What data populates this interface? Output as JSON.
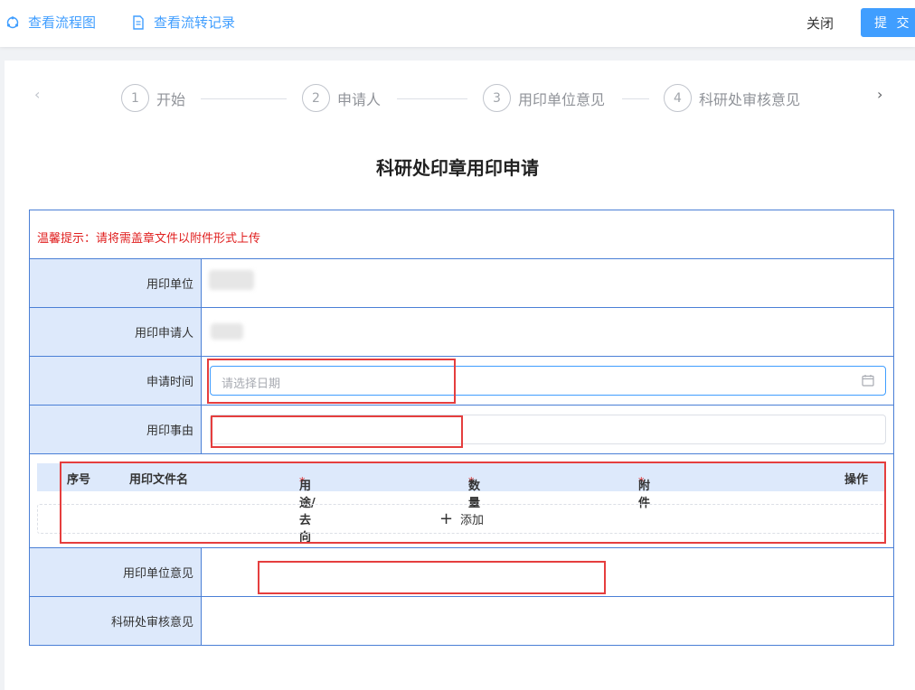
{
  "toolbar": {
    "view_flowchart": "查看流程图",
    "view_records": "查看流转记录",
    "close_label": "关闭",
    "submit_label": "提 交"
  },
  "steps": [
    {
      "num": "1",
      "label": "开始"
    },
    {
      "num": "2",
      "label": "申请人"
    },
    {
      "num": "3",
      "label": "用印单位意见"
    },
    {
      "num": "4",
      "label": "科研处审核意见"
    }
  ],
  "steps_nav": {
    "prev": "‹",
    "next": "›"
  },
  "form": {
    "title": "科研处印章用印申请",
    "notice": "温馨提示：请将需盖章文件以附件形式上传",
    "fields": {
      "unit_label": "用印单位",
      "applicant_label": "用印申请人",
      "apply_time_label": "申请时间",
      "apply_time_placeholder": "请选择日期",
      "reason_label": "用印事由",
      "unit_opinion_label": "用印单位意见",
      "research_opinion_label": "科研处审核意见"
    },
    "subtable": {
      "columns": [
        {
          "label": "序号",
          "required": false
        },
        {
          "label": "用印文件名",
          "required": false
        },
        {
          "label": "用途/去向",
          "required": true
        },
        {
          "label": "数量",
          "required": true
        },
        {
          "label": "附件",
          "required": true
        },
        {
          "label": "操作",
          "required": false
        }
      ],
      "required_mark": "*",
      "add_label": "添加",
      "add_icon": "+"
    }
  },
  "colors": {
    "accent": "#409eff",
    "label_bg": "#dde9fb",
    "border": "#4a7fd6",
    "notice": "#e02020",
    "highlight": "#e53e3e"
  },
  "icons": [
    "flowchart-icon",
    "document-icon",
    "calendar-icon",
    "plus-icon"
  ]
}
